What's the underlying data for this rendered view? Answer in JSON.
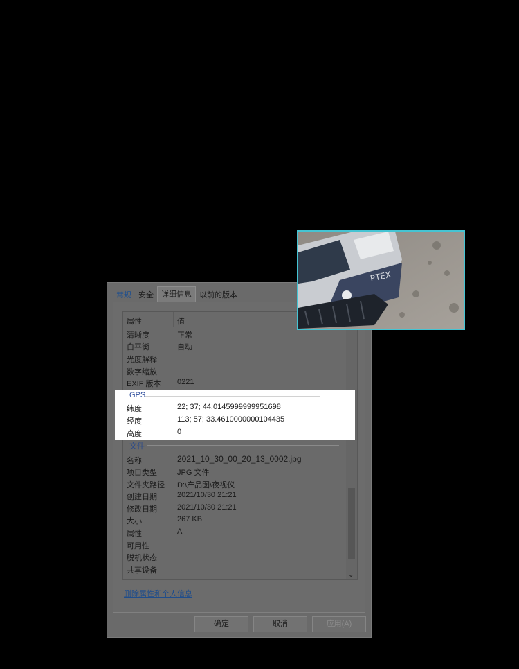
{
  "tabs": [
    "常规",
    "安全",
    "详细信息",
    "以前的版本"
  ],
  "columns": {
    "property": "属性",
    "value": "值"
  },
  "rows_top": [
    {
      "k": "清晰度",
      "v": "正常"
    },
    {
      "k": "白平衡",
      "v": "自动"
    },
    {
      "k": "光度解释",
      "v": ""
    },
    {
      "k": "数字缩放",
      "v": ""
    },
    {
      "k": "EXIF 版本",
      "v": "0221"
    }
  ],
  "gps": {
    "label": "GPS",
    "rows": [
      {
        "k": "纬度",
        "v": "22; 37; 44.0145999999951698"
      },
      {
        "k": "经度",
        "v": "113; 57; 33.4610000000104435"
      },
      {
        "k": "高度",
        "v": "0"
      }
    ]
  },
  "file": {
    "label": "文件",
    "rows": [
      {
        "k": "名称",
        "v": "2021_10_30_00_20_13_0002.jpg"
      },
      {
        "k": "项目类型",
        "v": "JPG 文件"
      },
      {
        "k": "文件夹路径",
        "v": "D:\\产品图\\夜视仪"
      },
      {
        "k": "创建日期",
        "v": "2021/10/30 21:21"
      },
      {
        "k": "修改日期",
        "v": "2021/10/30 21:21"
      },
      {
        "k": "大小",
        "v": "267 KB"
      },
      {
        "k": "属性",
        "v": "A"
      },
      {
        "k": "可用性",
        "v": ""
      },
      {
        "k": "脱机状态",
        "v": ""
      },
      {
        "k": "共享设备",
        "v": ""
      }
    ]
  },
  "link": "删除属性和个人信息",
  "buttons": {
    "ok": "确定",
    "cancel": "取消",
    "apply": "应用(A)"
  },
  "colors": {
    "highlight": "#ffffff",
    "thumb_border": "#45c4d3",
    "link": "#1f4d8c"
  },
  "icons": {
    "scroll_down": "chevron-down-icon"
  }
}
